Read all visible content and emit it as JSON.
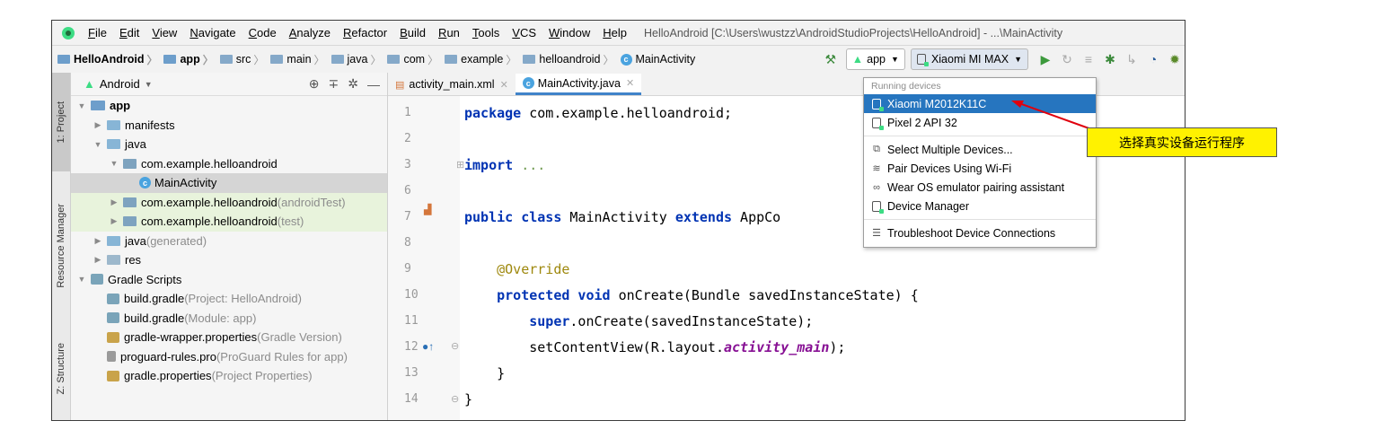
{
  "menubar": {
    "items": [
      "File",
      "Edit",
      "View",
      "Navigate",
      "Code",
      "Analyze",
      "Refactor",
      "Build",
      "Run",
      "Tools",
      "VCS",
      "Window",
      "Help"
    ],
    "window_title": "HelloAndroid [C:\\Users\\wustzz\\AndroidStudioProjects\\HelloAndroid] - ...\\MainActivity"
  },
  "breadcrumb": [
    "HelloAndroid",
    "app",
    "src",
    "main",
    "java",
    "com",
    "example",
    "helloandroid",
    "MainActivity"
  ],
  "toolbar": {
    "run_config": "app",
    "device": "Xiaomi MI MAX"
  },
  "side_tabs": {
    "project": "1: Project",
    "resource_manager": "Resource Manager",
    "structure": "Z: Structure"
  },
  "project_panel": {
    "view": "Android",
    "tree": [
      {
        "label": "app",
        "suffix": "",
        "indent": 0,
        "arrow": "▼",
        "icon": "module",
        "bold": true
      },
      {
        "label": "manifests",
        "suffix": "",
        "indent": 1,
        "arrow": "▶",
        "icon": "folder"
      },
      {
        "label": "java",
        "suffix": "",
        "indent": 1,
        "arrow": "▼",
        "icon": "folder"
      },
      {
        "label": "com.example.helloandroid",
        "suffix": "",
        "indent": 2,
        "arrow": "▼",
        "icon": "package"
      },
      {
        "label": "MainActivity",
        "suffix": "",
        "indent": 3,
        "arrow": "",
        "icon": "class",
        "selected": true
      },
      {
        "label": "com.example.helloandroid",
        "suffix": " (androidTest)",
        "indent": 2,
        "arrow": "▶",
        "icon": "package",
        "test": true
      },
      {
        "label": "com.example.helloandroid",
        "suffix": " (test)",
        "indent": 2,
        "arrow": "▶",
        "icon": "package",
        "test": true
      },
      {
        "label": "java",
        "suffix": " (generated)",
        "indent": 1,
        "arrow": "▶",
        "icon": "folder"
      },
      {
        "label": "res",
        "suffix": "",
        "indent": 1,
        "arrow": "▶",
        "icon": "res"
      },
      {
        "label": "Gradle Scripts",
        "suffix": "",
        "indent": 0,
        "arrow": "▼",
        "icon": "gradle"
      },
      {
        "label": "build.gradle",
        "suffix": " (Project: HelloAndroid)",
        "indent": 1,
        "arrow": "",
        "icon": "gradle"
      },
      {
        "label": "build.gradle",
        "suffix": " (Module: app)",
        "indent": 1,
        "arrow": "",
        "icon": "gradle"
      },
      {
        "label": "gradle-wrapper.properties",
        "suffix": " (Gradle Version)",
        "indent": 1,
        "arrow": "",
        "icon": "props"
      },
      {
        "label": "proguard-rules.pro",
        "suffix": " (ProGuard Rules for app)",
        "indent": 1,
        "arrow": "",
        "icon": "file"
      },
      {
        "label": "gradle.properties",
        "suffix": " (Project Properties)",
        "indent": 1,
        "arrow": "",
        "icon": "props"
      }
    ]
  },
  "editor": {
    "tabs": [
      {
        "label": "activity_main.xml"
      },
      {
        "label": "MainActivity.java",
        "active": true
      }
    ],
    "line_numbers": [
      "1",
      "2",
      "3",
      "6",
      "7",
      "8",
      "9",
      "10",
      "11",
      "12",
      "13",
      "14"
    ]
  },
  "device_popup": {
    "header": "Running devices",
    "devices": [
      "Xiaomi M2012K11C",
      "Pixel 2 API 32"
    ],
    "actions": [
      "Select Multiple Devices...",
      "Pair Devices Using Wi-Fi",
      "Wear OS emulator pairing assistant",
      "Device Manager"
    ],
    "troubleshoot": "Troubleshoot Device Connections"
  },
  "annotation": {
    "callout": "选择真实设备运行程序"
  },
  "colors": {
    "accent": "#2675bf",
    "callout_bg": "#fff200",
    "arrow": "#e0000e",
    "keyword": "#0033b3"
  }
}
